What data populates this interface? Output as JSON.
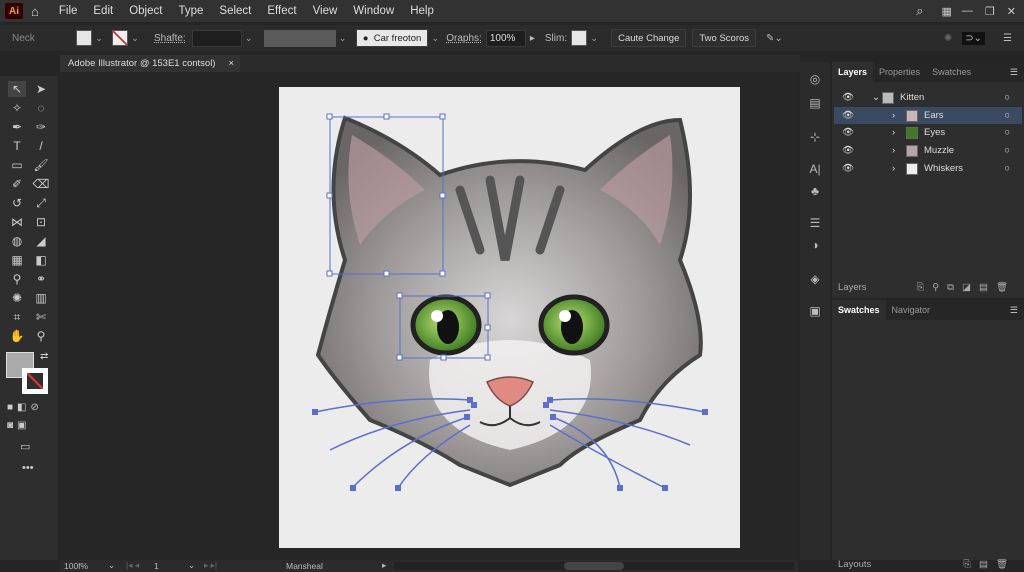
{
  "menubar": {
    "logo": "Ai",
    "items": [
      "File",
      "Edit",
      "Object",
      "Type",
      "Select",
      "Effect",
      "View",
      "Window",
      "Help"
    ]
  },
  "control": {
    "selection_label": "Neck",
    "stroke_label": "Shafte:",
    "style_button": "Car freoton",
    "opacity_label": "Oraphs:",
    "opacity_value": "100%",
    "slim_label": "Slim:",
    "btn1": "Caute Change",
    "btn2": "Two Scoros"
  },
  "document_tab": {
    "title": "Adobe Illustrator @ 153E1 contsol)",
    "close": "×"
  },
  "layers_panel": {
    "tabs": [
      "Layers",
      "Properties",
      "Swatches"
    ],
    "layers": [
      {
        "name": "Kitten",
        "expanded": true
      },
      {
        "name": "Ears",
        "selected": true
      },
      {
        "name": "Eyes"
      },
      {
        "name": "Muzzle"
      },
      {
        "name": "Whiskers"
      }
    ],
    "footer_label": "Layers"
  },
  "swatches_panel": {
    "tabs": [
      "Swatches",
      "Navigator"
    ],
    "footer_label": "Layouts"
  },
  "status": {
    "zoom": "100f%",
    "page": "1",
    "tool_name": "Mansheal"
  },
  "colors": {
    "selection": "#5a6fd0",
    "eye": "#6aa83a"
  }
}
